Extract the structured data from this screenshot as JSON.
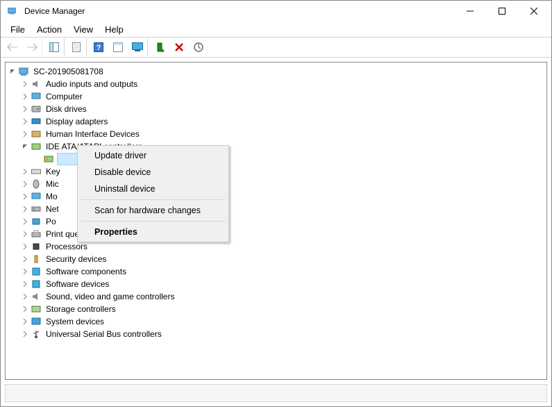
{
  "window": {
    "title": "Device Manager"
  },
  "menubar": {
    "file": "File",
    "action": "Action",
    "view": "View",
    "help": "Help"
  },
  "toolbar_icons": {
    "back": "back-icon",
    "forward": "forward-icon",
    "show_hide": "pane-icon",
    "properties": "properties-icon",
    "help": "help-icon",
    "options": "options-icon",
    "monitor": "monitor-icon",
    "add": "add-icon",
    "remove": "remove-icon",
    "scan": "scan-icon"
  },
  "tree": {
    "root": "SC-201905081708",
    "nodes": [
      {
        "key": "audio",
        "label": "Audio inputs and outputs"
      },
      {
        "key": "computer",
        "label": "Computer"
      },
      {
        "key": "disk",
        "label": "Disk drives"
      },
      {
        "key": "display",
        "label": "Display adapters"
      },
      {
        "key": "hid",
        "label": "Human Interface Devices"
      },
      {
        "key": "ide",
        "label": "IDE ATA/ATAPI controllers",
        "expanded": true
      },
      {
        "key": "ide_child",
        "label": ""
      },
      {
        "key": "keyboard",
        "label": "Key"
      },
      {
        "key": "mice",
        "label": "Mic"
      },
      {
        "key": "monitor",
        "label": "Mo"
      },
      {
        "key": "net",
        "label": "Net"
      },
      {
        "key": "ports",
        "label": "Po"
      },
      {
        "key": "printq",
        "label": "Print queues"
      },
      {
        "key": "proc",
        "label": "Processors"
      },
      {
        "key": "sec",
        "label": "Security devices"
      },
      {
        "key": "softc",
        "label": "Software components"
      },
      {
        "key": "softd",
        "label": "Software devices"
      },
      {
        "key": "sound",
        "label": "Sound, video and game controllers"
      },
      {
        "key": "storage",
        "label": "Storage controllers"
      },
      {
        "key": "system",
        "label": "System devices"
      },
      {
        "key": "usb",
        "label": "Universal Serial Bus controllers"
      }
    ]
  },
  "context_menu": {
    "update": "Update driver",
    "disable": "Disable device",
    "uninstall": "Uninstall device",
    "scan": "Scan for hardware changes",
    "properties": "Properties"
  }
}
